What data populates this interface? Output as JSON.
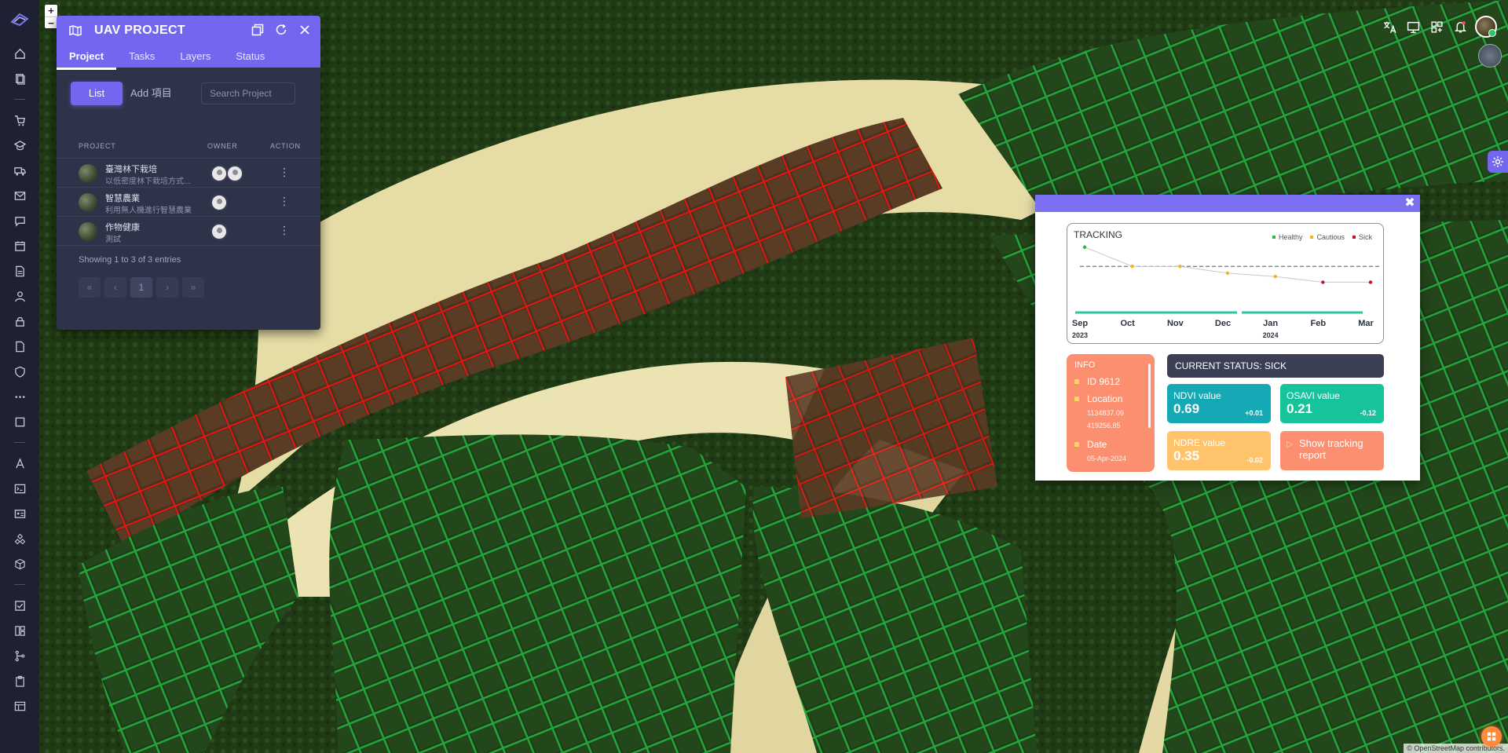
{
  "panel": {
    "title": "UAV PROJECT",
    "tabs": [
      "Project",
      "Tasks",
      "Layers",
      "Status"
    ],
    "list_label": "List",
    "add_label": "Add 項目",
    "search_placeholder": "Search Project",
    "columns": [
      "PROJECT",
      "OWNER",
      "ACTION"
    ],
    "rows": [
      {
        "name": "臺灣林下栽培",
        "desc": "以低密度林下栽培方式...",
        "owners": 2
      },
      {
        "name": "智慧農業",
        "desc": "利用無人機進行智慧農業...",
        "owners": 1
      },
      {
        "name": "作物健康",
        "desc": "測試",
        "owners": 1
      }
    ],
    "showing": "Showing 1 to 3 of 3 entries",
    "pager": [
      "«",
      "‹",
      "1",
      "›",
      "»"
    ]
  },
  "zoom": {
    "in": "+",
    "out": "−"
  },
  "popup": {
    "tracking_title": "TRACKING",
    "legend": [
      {
        "label": "Healthy",
        "color": "#2fb83c"
      },
      {
        "label": "Cautious",
        "color": "#f2b51b"
      },
      {
        "label": "Sick",
        "color": "#c0122a"
      }
    ],
    "info_label": "INFO",
    "id": "ID 9612",
    "location_label": "Location",
    "location_x": "1134837.09",
    "location_y": "419256.85",
    "date_label": "Date",
    "date_value": "05-Apr-2024",
    "status": "CURRENT STATUS: SICK",
    "ndvi_label": "NDVI value",
    "ndvi_value": "0.69",
    "ndvi_delta": "+0.01",
    "osavi_label": "OSAVI value",
    "osavi_value": "0.21",
    "osavi_delta": "-0.12",
    "ndre_label": "NDRE value",
    "ndre_value": "0.35",
    "ndre_delta": "-0.02",
    "report_label": "Show tracking report",
    "close": "✖"
  },
  "chart_data": {
    "type": "line",
    "x": [
      "Sep",
      "Oct",
      "Nov",
      "Dec",
      "Jan",
      "Feb",
      "Mar"
    ],
    "year_labels": [
      "2023",
      "2024"
    ],
    "points": [
      {
        "m": 0,
        "v": 0.92,
        "s": "Healthy"
      },
      {
        "m": 1,
        "v": 0.58,
        "s": "Cautious"
      },
      {
        "m": 2,
        "v": 0.58,
        "s": "Cautious"
      },
      {
        "m": 3,
        "v": 0.46,
        "s": "Cautious"
      },
      {
        "m": 4,
        "v": 0.4,
        "s": "Cautious"
      },
      {
        "m": 5,
        "v": 0.3,
        "s": "Sick"
      },
      {
        "m": 6,
        "v": 0.3,
        "s": "Sick"
      }
    ],
    "threshold": 0.58,
    "ylim": [
      0,
      1
    ]
  },
  "attribution": "© OpenStreetMap contributors."
}
